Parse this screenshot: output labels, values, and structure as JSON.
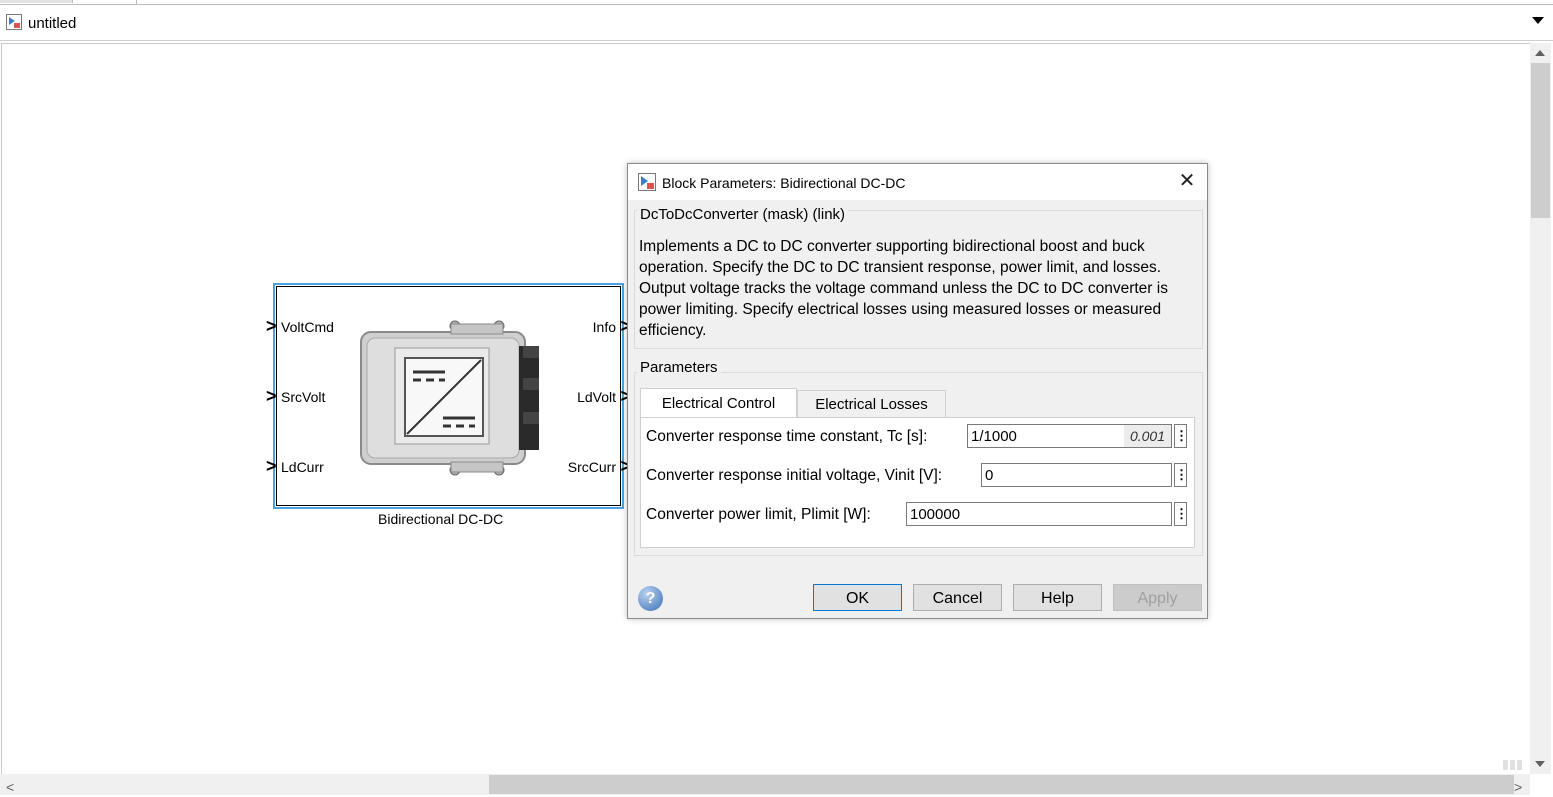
{
  "window": {
    "breadcrumb": "untitled"
  },
  "model": {
    "block": {
      "name": "Bidirectional DC-DC",
      "inputs": [
        "VoltCmd",
        "SrcVolt",
        "LdCurr"
      ],
      "outputs": [
        "Info",
        "LdVolt",
        "SrcCurr"
      ]
    }
  },
  "dialog": {
    "title": "Block Parameters: Bidirectional DC-DC",
    "mask_header": "DcToDcConverter (mask) (link)",
    "description": "Implements a DC to DC converter supporting bidirectional boost and buck operation.  Specify the DC to DC transient response, power limit, and losses.  Output voltage tracks the voltage command unless the DC to DC converter is power limiting.  Specify electrical losses using measured losses or measured efficiency.",
    "parameters_header": "Parameters",
    "tabs": [
      "Electrical Control",
      "Electrical Losses"
    ],
    "active_tab": "Electrical Control",
    "params": [
      {
        "label": "Converter response time constant, Tc [s]:",
        "value": "1/1000",
        "evaluated": "0.001"
      },
      {
        "label": "Converter response initial voltage, Vinit [V]:",
        "value": "0"
      },
      {
        "label": "Converter power limit, Plimit [W]:",
        "value": "100000"
      }
    ],
    "buttons": {
      "ok": "OK",
      "cancel": "Cancel",
      "help": "Help",
      "apply": "Apply"
    },
    "help_icon_glyph": "?",
    "close_glyph": "✕"
  },
  "colors": {
    "selection": "#4aa3df",
    "dialog_bg": "#f0f0f0",
    "default_button_border": "#0078d7"
  }
}
